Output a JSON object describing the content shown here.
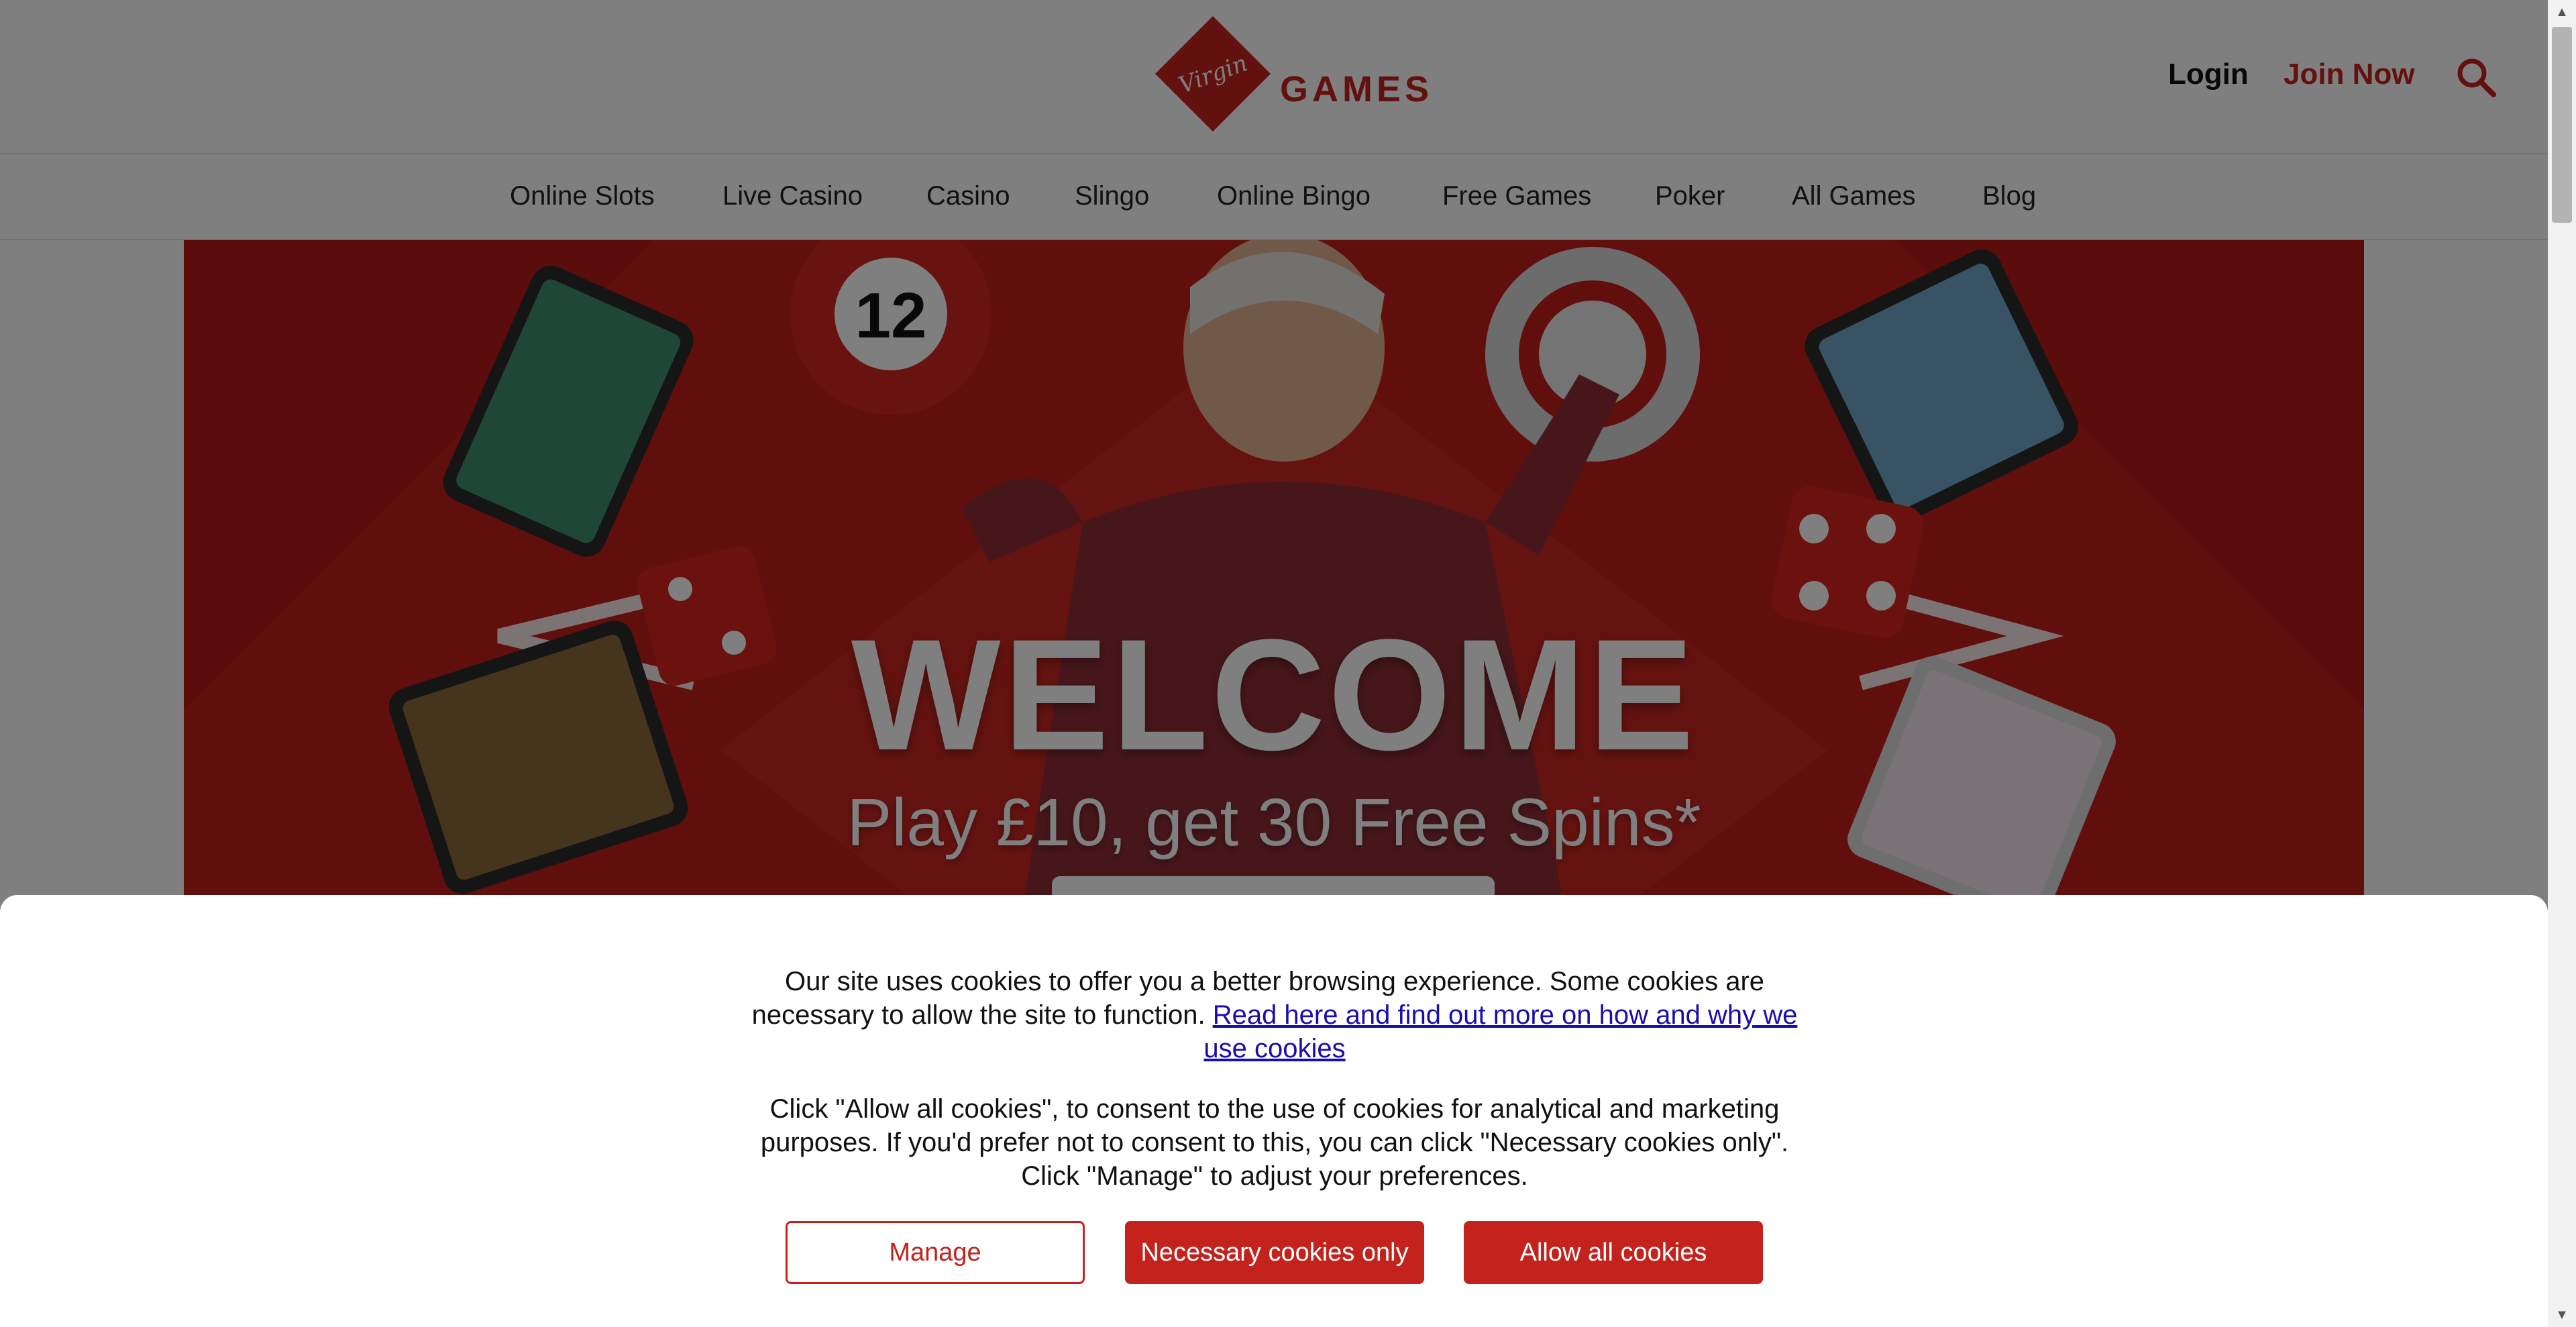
{
  "header": {
    "logo_script": "Virgin",
    "logo_word": "GAMES",
    "login_label": "Login",
    "join_label": "Join Now",
    "search_icon": "search-icon"
  },
  "nav": {
    "items": [
      {
        "label": "Online Slots"
      },
      {
        "label": "Live Casino"
      },
      {
        "label": "Casino"
      },
      {
        "label": "Slingo"
      },
      {
        "label": "Online Bingo"
      },
      {
        "label": "Free Games"
      },
      {
        "label": "Poker"
      },
      {
        "label": "All Games"
      },
      {
        "label": "Blog"
      }
    ]
  },
  "hero": {
    "headline": "WELCOME",
    "offer": "Play £10, get 30 Free Spins*",
    "ball_number": "12"
  },
  "cookie_banner": {
    "text_1": "Our site uses cookies to offer you a better browsing experience. Some cookies are necessary to allow the site to function.",
    "link_text": "Read here and find out more on how and why we use cookies",
    "text_2": "Click \"Allow all cookies\", to consent to the use of cookies for analytical and marketing purposes. If you'd prefer not to consent to this, you can click \"Necessary cookies only\". Click \"Manage\" to adjust your preferences.",
    "buttons": {
      "manage": "Manage",
      "necessary": "Necessary cookies only",
      "allow_all": "Allow all cookies"
    }
  },
  "colors": {
    "brand_red": "#c4221d",
    "link_blue": "#1a0dab",
    "overlay": "rgba(0,0,0,0.5)"
  }
}
